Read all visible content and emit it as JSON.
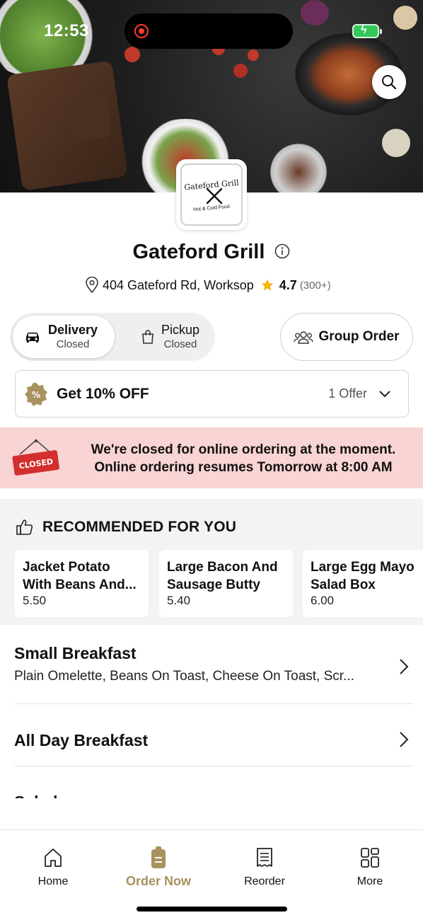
{
  "status_bar": {
    "time": "12:53"
  },
  "colors": {
    "accent": "#a8925e",
    "closed_banner_bg": "#f9d4d4",
    "star": "#f4b400",
    "closed_sign": "#d32f2f"
  },
  "logo": {
    "title": "Gateford Grill",
    "subtitle": "Hot & Cold Food"
  },
  "restaurant": {
    "name": "Gateford Grill",
    "address": "404 Gateford Rd, Worksop",
    "rating": "4.7",
    "rating_count": "(300+)"
  },
  "order_mode": {
    "delivery": {
      "label": "Delivery",
      "status": "Closed",
      "icon": "car-icon"
    },
    "pickup": {
      "label": "Pickup",
      "status": "Closed",
      "icon": "bag-icon"
    }
  },
  "group_order": {
    "label": "Group Order",
    "icon": "group-icon"
  },
  "offer": {
    "title": "Get 10% OFF",
    "count": "1 Offer"
  },
  "closed_notice": {
    "sign_text": "CLOSED",
    "line1": "We're closed for online ordering at the moment.",
    "line2": "Online ordering resumes Tomorrow at 8:00 AM"
  },
  "recommended": {
    "heading": "RECOMMENDED FOR YOU",
    "items": [
      {
        "name": "Jacket Potato With Beans And...",
        "price": "5.50"
      },
      {
        "name": "Large Bacon And Sausage Butty",
        "price": "5.40"
      },
      {
        "name": "Large Egg Mayo Salad Box",
        "price": "6.00"
      }
    ]
  },
  "categories": [
    {
      "title": "Small Breakfast",
      "description": "Plain Omelette, Beans On Toast, Cheese On Toast, Scr..."
    },
    {
      "title": "All Day Breakfast",
      "description": ""
    },
    {
      "title": "Salads",
      "description": ""
    }
  ],
  "bottom_nav": [
    {
      "label": "Home",
      "icon": "home-icon"
    },
    {
      "label": "Order Now",
      "icon": "order-icon"
    },
    {
      "label": "Reorder",
      "icon": "receipt-icon"
    },
    {
      "label": "More",
      "icon": "grid-icon"
    }
  ]
}
